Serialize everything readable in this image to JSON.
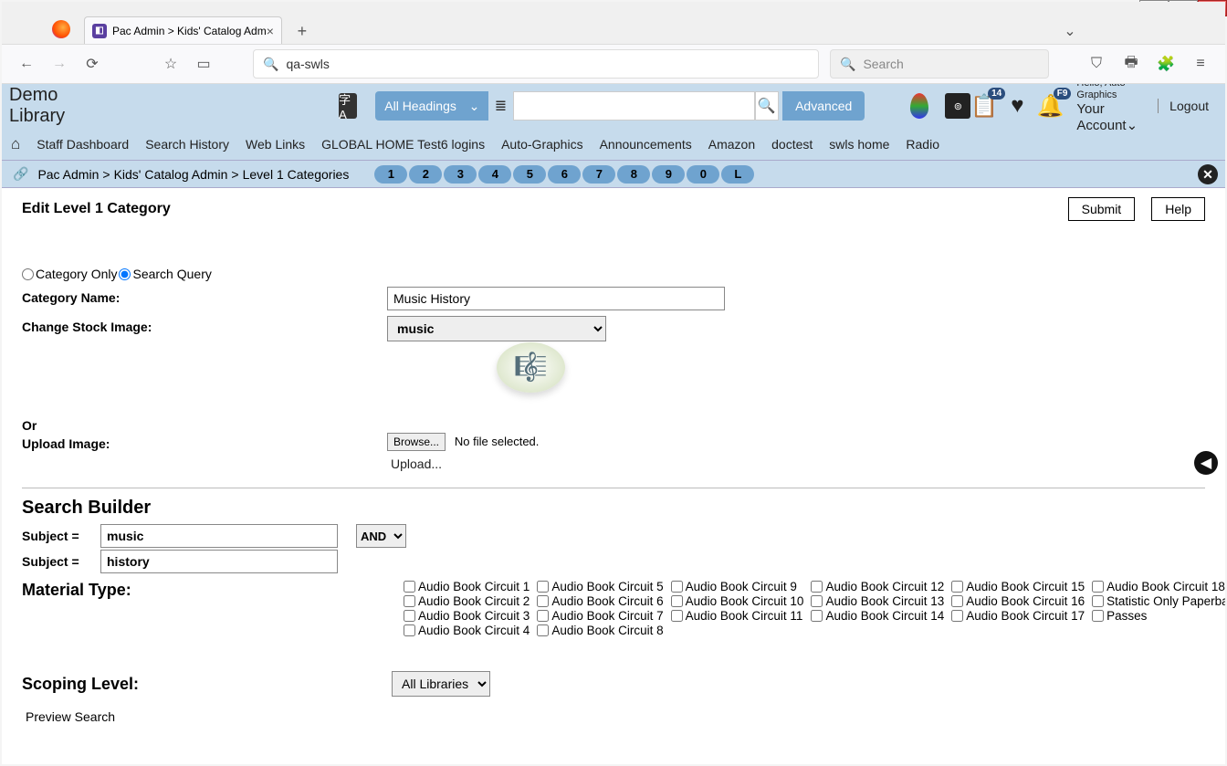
{
  "os": {
    "minimize": "—",
    "maximize": "❐",
    "close": "✕"
  },
  "browser": {
    "tab_title": "Pac Admin > Kids' Catalog Adm",
    "url": "qa-swls",
    "search_placeholder": "Search"
  },
  "app_header": {
    "title": "Demo Library",
    "heading_select": "All Headings",
    "advanced": "Advanced",
    "list_badge": "14",
    "bell_badge": "F9",
    "hello": "Hello, Auto-Graphics",
    "your_account": "Your Account",
    "logout": "Logout"
  },
  "nav": {
    "items": [
      "Staff Dashboard",
      "Search History",
      "Web Links",
      "GLOBAL HOME Test6 logins",
      "Auto-Graphics",
      "Announcements",
      "Amazon",
      "doctest",
      "swls home",
      "Radio"
    ]
  },
  "crumb": {
    "a": "Pac Admin",
    "b": "Kids' Catalog Admin",
    "c": "Level 1 Categories",
    "pills": [
      "1",
      "2",
      "3",
      "4",
      "5",
      "6",
      "7",
      "8",
      "9",
      "0",
      "L"
    ]
  },
  "page": {
    "heading": "Edit Level 1 Category",
    "submit": "Submit",
    "help": "Help",
    "radio_cat": "Category Only",
    "radio_search": "Search Query",
    "label_name": "Category Name:",
    "value_name": "Music History",
    "label_stock": "Change Stock Image:",
    "value_stock": "music",
    "or": "Or",
    "label_upload": "Upload Image:",
    "browse": "Browse...",
    "nofile": "No file selected.",
    "upload": "Upload...",
    "sb_head": "Search Builder",
    "subj": "Subject =",
    "subj_val1": "music",
    "subj_val2": "history",
    "and": "AND",
    "mt_head": "Material Type:",
    "scope_head": "Scoping Level:",
    "scope_val": "All Libraries",
    "preview": "Preview Search"
  },
  "mt": [
    "Audio Book Circuit 1",
    "Audio Book Circuit 5",
    "Audio Book Circuit 9",
    "Audio Book Circuit 12",
    "Audio Book Circuit 15",
    "Audio Book Circuit 18",
    "Audio Book Circuit 2",
    "Audio Book Circuit 6",
    "Audio Book Circuit 10",
    "Audio Book Circuit 13",
    "Audio Book Circuit 16",
    "Statistic Only Paperback",
    "Audio Book Circuit 3",
    "Audio Book Circuit 7",
    "Audio Book Circuit 11",
    "Audio Book Circuit 14",
    "Audio Book Circuit 17",
    "Passes",
    "Audio Book Circuit 4",
    "Audio Book Circuit 8"
  ]
}
